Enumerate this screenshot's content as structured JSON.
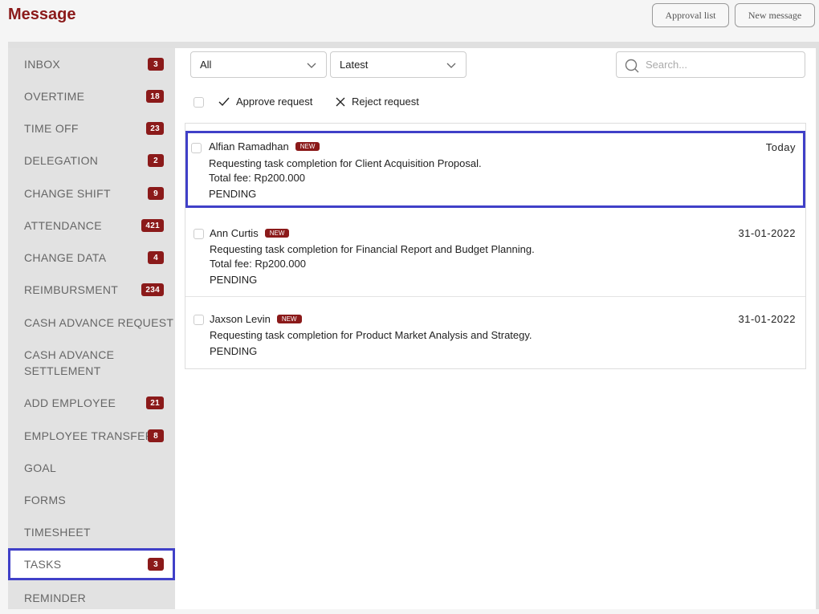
{
  "header": {
    "title": "Message",
    "approval_list": "Approval list",
    "new_message": "New message"
  },
  "sidebar": {
    "items": [
      {
        "label": "INBOX",
        "count": "3"
      },
      {
        "label": "OVERTIME",
        "count": "18"
      },
      {
        "label": "TIME OFF",
        "count": "23"
      },
      {
        "label": "DELEGATION",
        "count": "2"
      },
      {
        "label": "CHANGE SHIFT",
        "count": "9"
      },
      {
        "label": "ATTENDANCE",
        "count": "421"
      },
      {
        "label": "CHANGE DATA",
        "count": "4"
      },
      {
        "label": "REIMBURSMENT",
        "count": "234"
      },
      {
        "label": "CASH ADVANCE REQUEST",
        "count": ""
      },
      {
        "label": "CASH ADVANCE SETTLEMENT",
        "count": ""
      },
      {
        "label": "ADD EMPLOYEE",
        "count": "21"
      },
      {
        "label": "EMPLOYEE TRANSFER",
        "count": "8"
      },
      {
        "label": "GOAL",
        "count": ""
      },
      {
        "label": "FORMS",
        "count": ""
      },
      {
        "label": "TIMESHEET",
        "count": ""
      },
      {
        "label": "TASKS",
        "count": "3",
        "active": true
      },
      {
        "label": "REMINDER",
        "count": ""
      }
    ]
  },
  "filters": {
    "type_value": "All",
    "sort_value": "Latest",
    "search_placeholder": "Search..."
  },
  "actions": {
    "approve": "Approve request",
    "reject": "Reject request"
  },
  "messages": [
    {
      "sender": "Alfian Ramadhan",
      "badge": "NEW",
      "date": "Today",
      "description": "Requesting task completion for Client Acquisition Proposal.",
      "fee": "Total fee: Rp200.000",
      "status": "PENDING"
    },
    {
      "sender": "Ann Curtis",
      "badge": "NEW",
      "date": "31-01-2022",
      "description": "Requesting task completion for Financial Report and Budget Planning.",
      "fee": "Total fee: Rp200.000",
      "status": "PENDING"
    },
    {
      "sender": "Jaxson Levin",
      "badge": "NEW",
      "date": "31-01-2022",
      "description": "Requesting task completion for Product Market Analysis and Strategy.",
      "status": "PENDING"
    }
  ],
  "colors": {
    "brand": "#8b1a1a",
    "highlight": "#4040c8"
  }
}
